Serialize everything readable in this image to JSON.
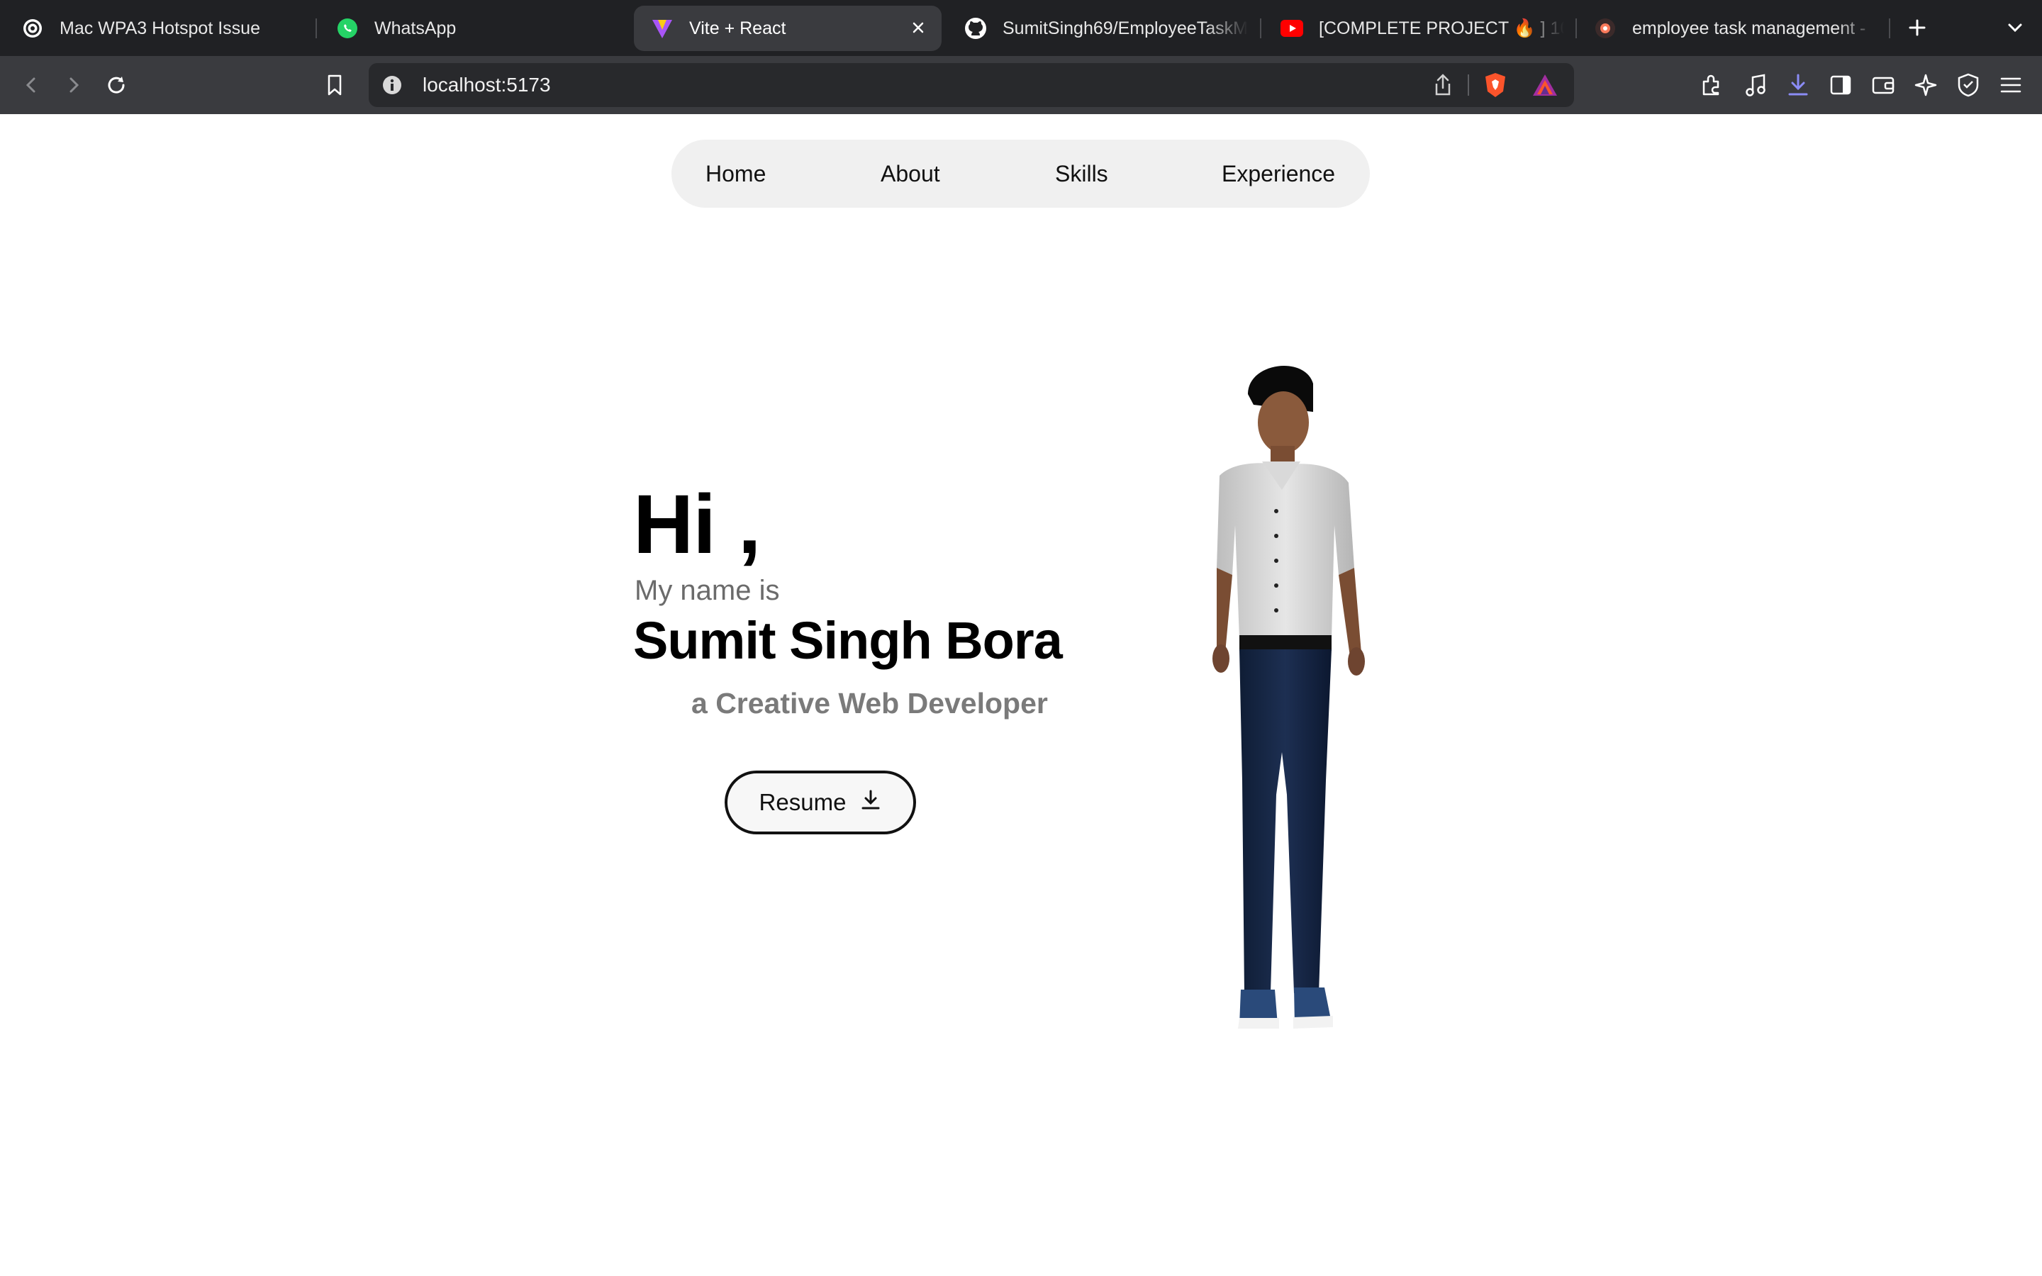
{
  "browser": {
    "tabs": [
      {
        "title": "Mac WPA3 Hotspot Issue",
        "icon": "openai-icon"
      },
      {
        "title": "WhatsApp",
        "icon": "whatsapp-icon"
      },
      {
        "title": "Vite + React",
        "icon": "vite-icon",
        "active": true
      },
      {
        "title": "SumitSingh69/EmployeeTaskM",
        "icon": "github-icon"
      },
      {
        "title": "[COMPLETE PROJECT 🔥 ] 10",
        "icon": "youtube-icon"
      },
      {
        "title": "employee task management -",
        "icon": "brave-search-icon"
      }
    ],
    "url": "localhost:5173"
  },
  "nav": {
    "items": [
      "Home",
      "About",
      "Skills",
      "Experience"
    ]
  },
  "hero": {
    "greeting": "Hi ,",
    "intro": "My name is",
    "name": "Sumit Singh Bora",
    "tagline": "a Creative Web Developer",
    "resume_label": "Resume"
  },
  "colors": {
    "tabbar": "#202124",
    "toolbar": "#3a3b3f",
    "nav_bg": "#f0f0f0",
    "tagline": "#7a7a7a"
  }
}
